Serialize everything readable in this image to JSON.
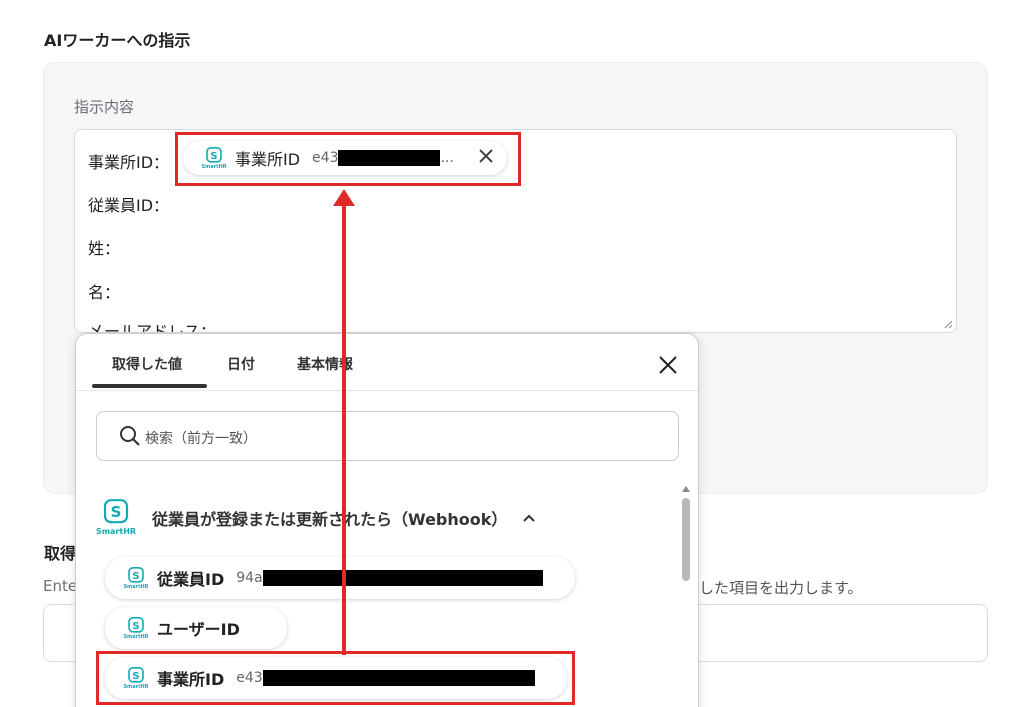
{
  "section": {
    "title": "AIワーカーへの指示"
  },
  "instruction": {
    "label": "指示内容",
    "lines": [
      "事業所ID：",
      "従業員ID：",
      "姓：",
      "名：",
      "メールアドレス："
    ],
    "pill": {
      "label": "事業所ID",
      "value_prefix": "e43",
      "ellipsis": "..."
    }
  },
  "dropdown": {
    "tabs": [
      "取得した値",
      "日付",
      "基本情報"
    ],
    "search_placeholder": "検索（前方一致）",
    "group": {
      "title": "従業員が登録または更新されたら（Webhook）",
      "app": "SmartHR"
    },
    "items": [
      {
        "label": "従業員ID",
        "value_prefix": "94a"
      },
      {
        "label": "ユーザーID",
        "value_prefix": ""
      },
      {
        "label": "事業所ID",
        "value_prefix": "e43"
      }
    ]
  },
  "output": {
    "title_fragment": "取得",
    "desc_left": "Ente",
    "desc_right": "した項目を出力します。"
  },
  "colors": {
    "accent": "#13a9b5",
    "highlight": "#e02a2a",
    "panel_bg": "#f5f6f7"
  },
  "icons": [
    "smarthr-logo-icon",
    "close-icon",
    "search-icon",
    "chevron-up-icon",
    "arrow-up-icon"
  ]
}
